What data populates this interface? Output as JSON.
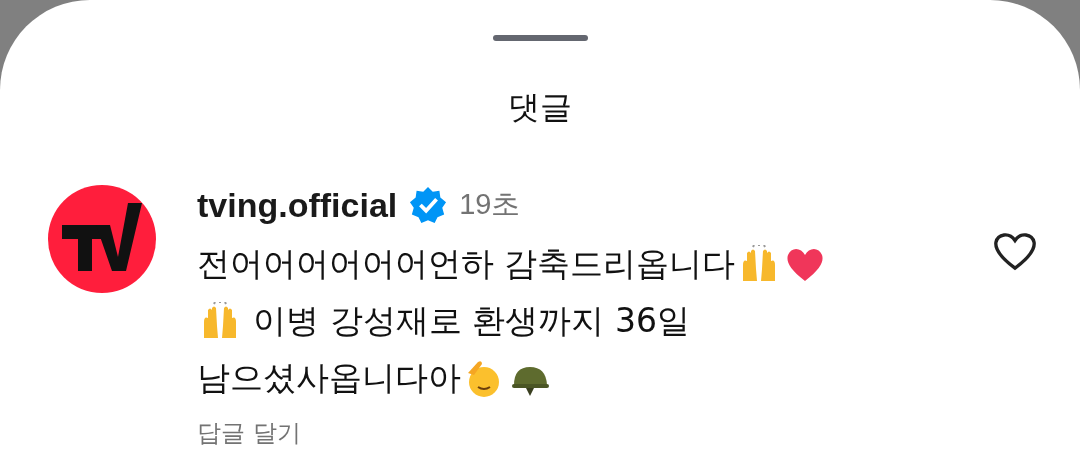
{
  "sheet": {
    "title": "댓글"
  },
  "comment": {
    "username": "tving.official",
    "verified": true,
    "time": "19초",
    "liked": false,
    "reply": "답글 달기",
    "lines": [
      [
        {
          "kind": "text",
          "text": "전어어어어어어언하 감축드리옵니다"
        },
        {
          "kind": "raised-hands"
        },
        {
          "kind": "heart"
        }
      ],
      [
        {
          "kind": "raised-hands"
        },
        {
          "kind": "text",
          "text": " 이병 강성재로 환생까지 36일"
        }
      ],
      [
        {
          "kind": "text",
          "text": "남으셨사옵니다아"
        },
        {
          "kind": "salute"
        },
        {
          "kind": "helmet"
        }
      ]
    ]
  }
}
